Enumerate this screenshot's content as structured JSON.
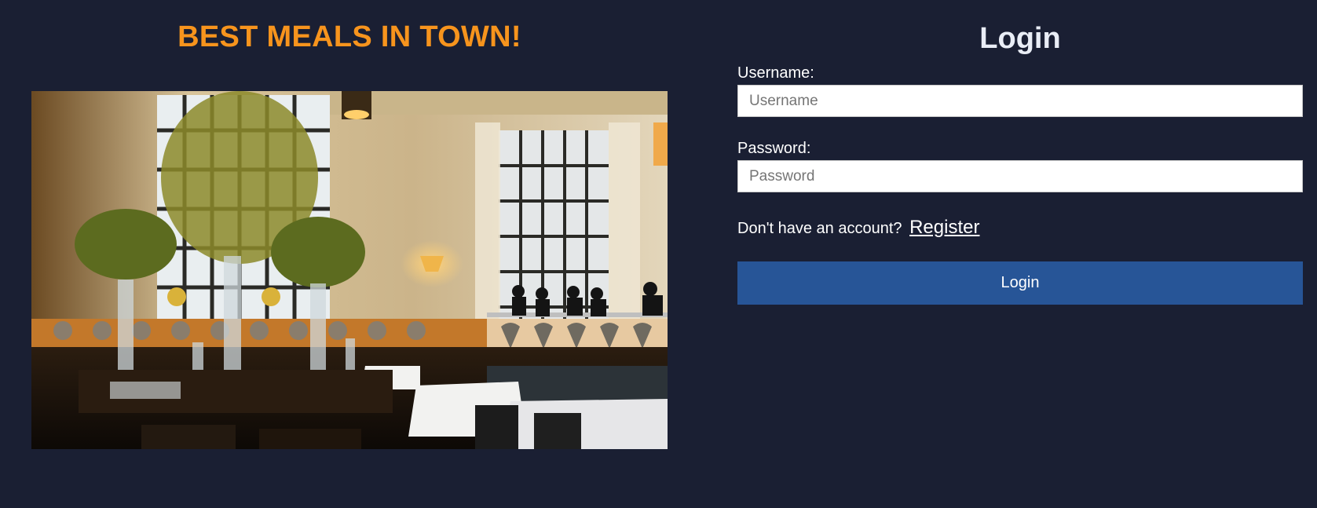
{
  "hero": {
    "heading": "BEST MEALS IN TOWN!",
    "image_subject": "restaurant dining room"
  },
  "login_form": {
    "title": "Login",
    "username_label": "Username:",
    "username_placeholder": "Username",
    "password_label": "Password:",
    "password_placeholder": "Password",
    "register_prompt": "Don't have an account?",
    "register_link": "Register",
    "submit_label": "Login"
  },
  "colors": {
    "background": "#1a1f33",
    "heading_accent": "#f7941d",
    "button": "#275597"
  }
}
